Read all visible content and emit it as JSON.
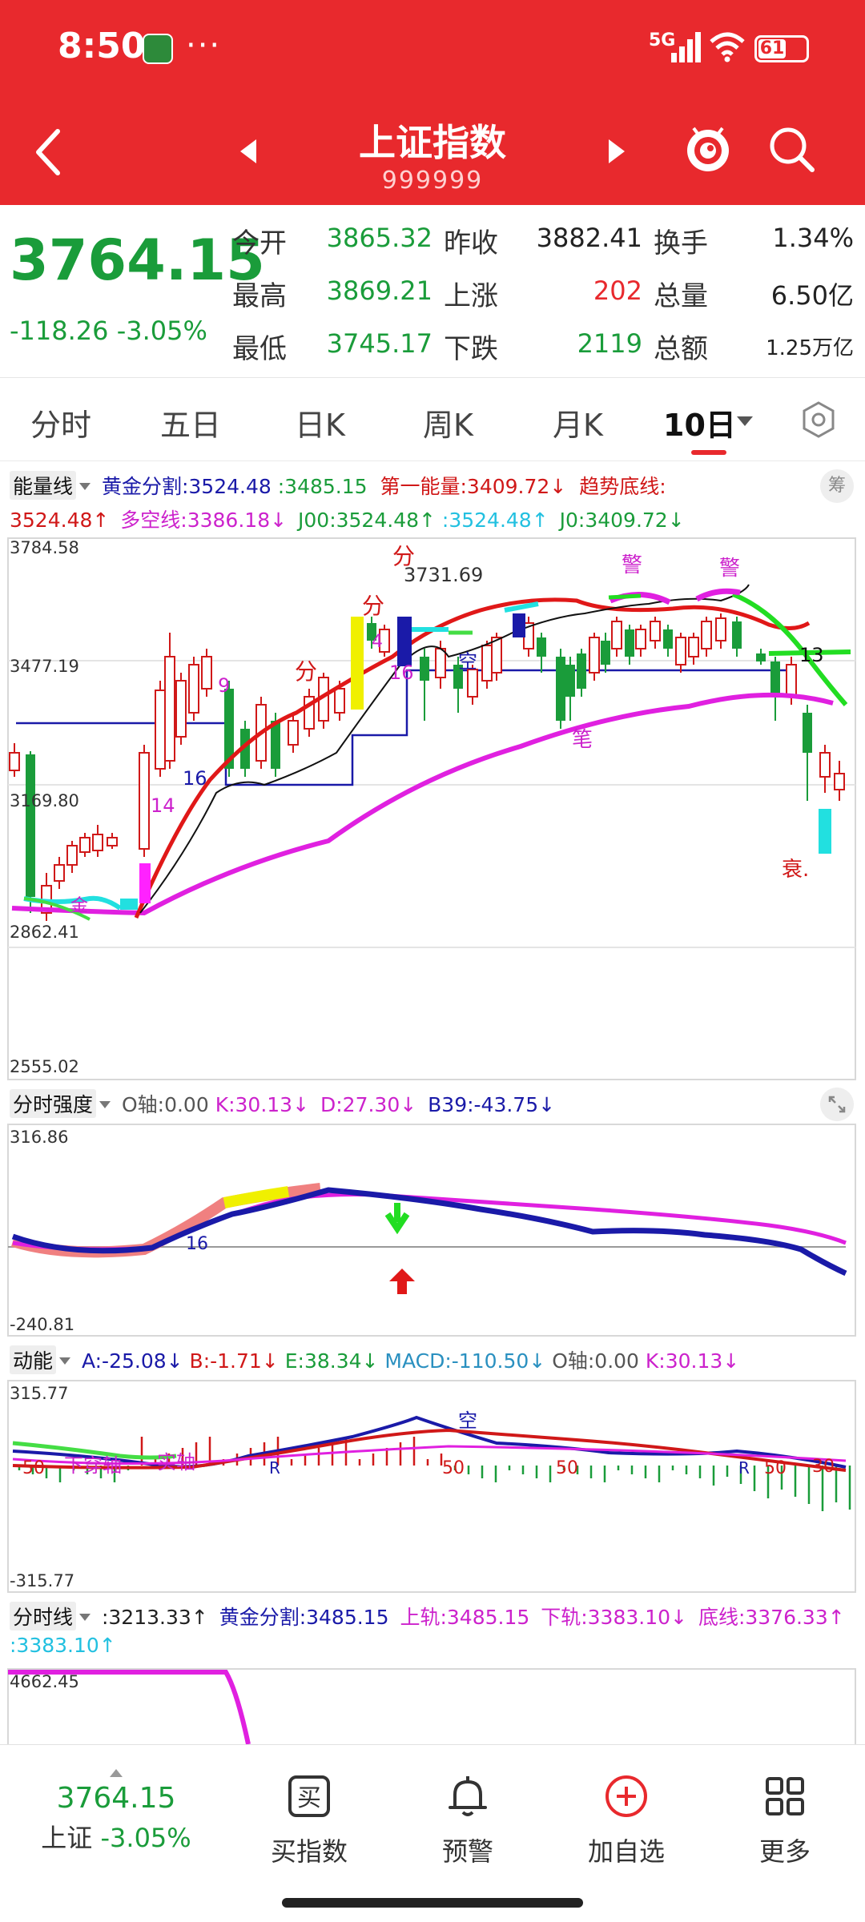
{
  "status_bar": {
    "time": "8:50",
    "dots": "···",
    "network": "5G",
    "battery": "61"
  },
  "nav": {
    "title": "上证指数",
    "code": "999999"
  },
  "quote": {
    "price": "3764.15",
    "change": "-118.26",
    "change_pct": "-3.05%",
    "fields": [
      {
        "label": "今开",
        "value": "3865.32",
        "color": "#1a9c3a"
      },
      {
        "label": "昨收",
        "value": "3882.41",
        "color": "#222222"
      },
      {
        "label": "换手",
        "value": "1.34%",
        "color": "#222222"
      },
      {
        "label": "最高",
        "value": "3869.21",
        "color": "#1a9c3a"
      },
      {
        "label": "上涨",
        "value": "202",
        "color": "#e8292d"
      },
      {
        "label": "总量",
        "value": "6.50亿",
        "color": "#222222"
      },
      {
        "label": "最低",
        "value": "3745.17",
        "color": "#1a9c3a"
      },
      {
        "label": "下跌",
        "value": "2119",
        "color": "#1a9c3a"
      },
      {
        "label": "总额",
        "value": "1.25万亿",
        "color": "#222222"
      }
    ]
  },
  "tabs": [
    {
      "label": "分时"
    },
    {
      "label": "五日"
    },
    {
      "label": "日K"
    },
    {
      "label": "周K"
    },
    {
      "label": "月K"
    },
    {
      "label": "10日"
    }
  ],
  "active_tab": "10日",
  "panel1": {
    "name": "能量线",
    "corner": "筹",
    "line1": [
      {
        "t": "黄金分割:3524.48",
        "c": "#1a1aa8"
      },
      {
        "t": ":3485.15",
        "c": "#1a9c3a"
      },
      {
        "t": "第一能量:3409.72↓",
        "c": "#d01818"
      },
      {
        "t": "趋势底线:",
        "c": "#d01818"
      }
    ],
    "line2": [
      {
        "t": "3524.48↑",
        "c": "#d01818"
      },
      {
        "t": "多空线:3386.18↓",
        "c": "#cc22cc"
      },
      {
        "t": "J00:3524.48↑",
        "c": "#1a9c3a"
      },
      {
        "t": ":3524.48↑",
        "c": "#22c0e0"
      },
      {
        "t": "J0:3409.72↓",
        "c": "#1a9c3a"
      }
    ],
    "axis": [
      "3784.58",
      "3477.19",
      "3169.80",
      "2862.41",
      "2555.02"
    ]
  },
  "panel2": {
    "name": "分时强度",
    "items": [
      {
        "t": "O轴:0.00",
        "c": "#555555"
      },
      {
        "t": "K:30.13↓",
        "c": "#cc22cc"
      },
      {
        "t": "D:27.30↓",
        "c": "#cc22cc"
      },
      {
        "t": "B39:-43.75↓",
        "c": "#1a1aa8"
      }
    ],
    "axis": [
      "316.86",
      "-240.81"
    ]
  },
  "panel3": {
    "name": "动能",
    "items": [
      {
        "t": "A:-25.08↓",
        "c": "#1a1aa8"
      },
      {
        "t": "B:-1.71↓",
        "c": "#d01818"
      },
      {
        "t": "E:38.34↓",
        "c": "#1a9c3a"
      },
      {
        "t": "MACD:-110.50↓",
        "c": "#2a90c0"
      },
      {
        "t": "O轴:0.00",
        "c": "#555555"
      },
      {
        "t": "K:30.13↓",
        "c": "#cc22cc"
      }
    ],
    "axis": [
      "315.77",
      "-315.77"
    ]
  },
  "panel4": {
    "name": "分时线",
    "line1": [
      {
        "t": ":3213.33↑",
        "c": "#222222"
      },
      {
        "t": "黄金分割:3485.15",
        "c": "#1a1aa8"
      },
      {
        "t": "上轨:3485.15",
        "c": "#cc22cc"
      },
      {
        "t": "下轨:3383.10↓",
        "c": "#cc22cc"
      },
      {
        "t": "底线:3376.33↑",
        "c": "#cc22cc"
      }
    ],
    "line2": [
      {
        "t": ":3383.10↑",
        "c": "#22c0e0"
      }
    ],
    "axis": [
      "4662.45"
    ]
  },
  "annotations": {
    "fen1": "分",
    "fen2": "分",
    "fen3": "分",
    "n9": "9",
    "n16a": "16",
    "n14": "14",
    "n4": "4",
    "n16b": "16",
    "price_label": "3731.69",
    "kong": "空",
    "jing1": "警",
    "jing2": "警",
    "bi": "笔",
    "n13": "13",
    "shuai": "衰.",
    "jin": "金",
    "p2_16": "16",
    "p3_kong": "空",
    "p3_xia": "下穿轴",
    "p3_shi": "实轴",
    "p3_r1": "R",
    "p3_r2": "R",
    "p3_50a": "50",
    "p3_50b": "50",
    "p3_50c": "50",
    "p3_50d": "50",
    "p3_30": "30"
  },
  "toolbar": {
    "price": "3764.15",
    "index": "上证",
    "pct": "-3.05%",
    "buy_icon": "买",
    "items": [
      {
        "label": "买指数",
        "icon": "buy-icon"
      },
      {
        "label": "预警",
        "icon": "bell-icon"
      },
      {
        "label": "加自选",
        "icon": "add-circle-icon"
      },
      {
        "label": "更多",
        "icon": "grid-icon"
      }
    ]
  },
  "colors": {
    "header_red": "#e8292d",
    "up_red": "#e8292d",
    "down_green": "#1a9c3a",
    "magenta": "#e020e0",
    "navy": "#1a1aa8"
  }
}
